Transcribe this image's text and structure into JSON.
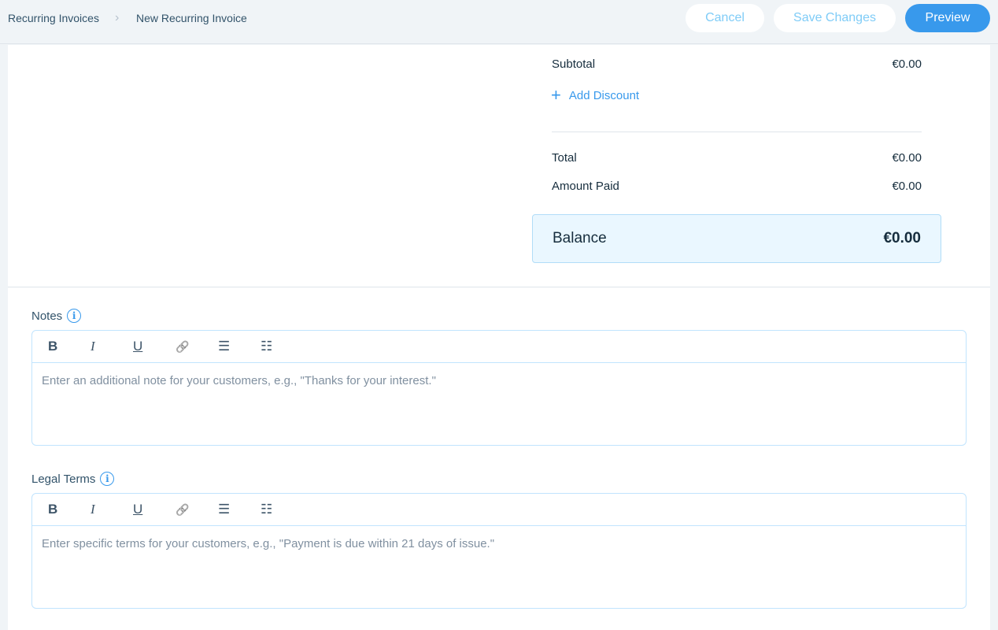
{
  "breadcrumb": {
    "parent": "Recurring Invoices",
    "current": "New Recurring Invoice"
  },
  "actions": {
    "cancel": "Cancel",
    "save": "Save Changes",
    "preview": "Preview"
  },
  "summary": {
    "subtotal_label": "Subtotal",
    "subtotal": "€0.00",
    "add_discount": "Add Discount",
    "total_label": "Total",
    "total": "€0.00",
    "paid_label": "Amount Paid",
    "paid": "€0.00",
    "balance_label": "Balance",
    "balance": "€0.00"
  },
  "notes": {
    "label": "Notes",
    "placeholder": "Enter an additional note for your customers, e.g., \"Thanks for your interest.\""
  },
  "legal": {
    "label": "Legal Terms",
    "placeholder": "Enter specific terms for your customers, e.g., \"Payment is due within 21 days of issue.\""
  },
  "toolbar": {
    "bold": "B",
    "italic": "I",
    "underline": "U",
    "link": "🔗",
    "bullets": "☰",
    "numbered": "☷"
  },
  "icons": {
    "info": "i",
    "plus": "+",
    "chevron": "›"
  },
  "colors": {
    "accent": "#3899ec",
    "balance_bg": "#eaf7ff"
  }
}
